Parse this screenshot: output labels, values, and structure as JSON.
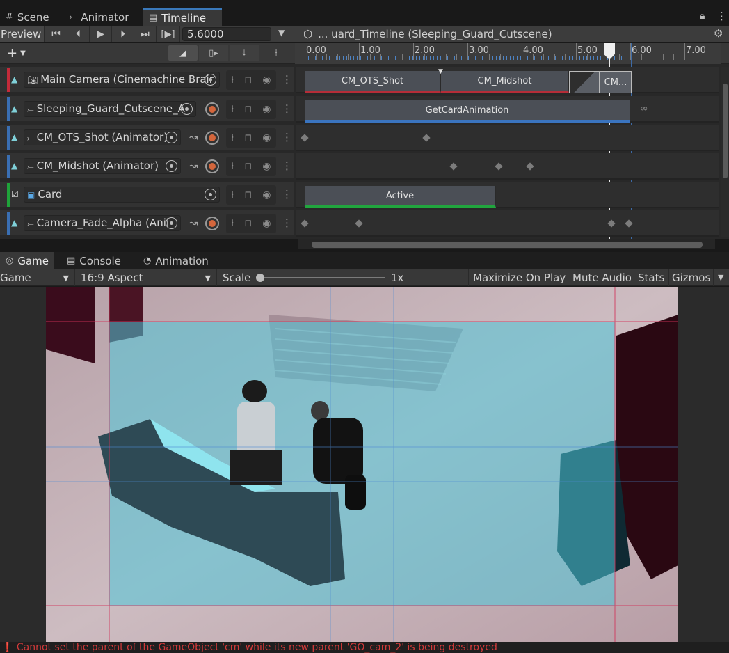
{
  "tabs": {
    "scene": "Scene",
    "animator": "Animator",
    "timeline": "Timeline"
  },
  "toolbar": {
    "preview": "Preview",
    "current_time": "5.6000",
    "timeline_path": "... uard_Timeline (Sleeping_Guard_Cutscene)"
  },
  "ruler": {
    "ticks": [
      "0.00",
      "1.00",
      "2.00",
      "3.00",
      "4.00",
      "5.00",
      "6.00",
      "7.00"
    ]
  },
  "tracks": [
    {
      "name": "Main Camera (Cinemachine Brair",
      "color": "#c42b3a",
      "clips": [
        "CM_OTS_Shot",
        "CM_Midshot",
        "CM..."
      ]
    },
    {
      "name": "Sleeping_Guard_Cutscene_A",
      "color": "#3a6fb3",
      "clips": [
        "GetCardAnimation"
      ]
    },
    {
      "name": "CM_OTS_Shot (Animator)",
      "color": "#3a6fb3",
      "clips": []
    },
    {
      "name": "CM_Midshot (Animator)",
      "color": "#3a6fb3",
      "clips": []
    },
    {
      "name": "Card",
      "color": "#1fa33a",
      "clips": [
        "Active"
      ]
    },
    {
      "name": "Camera_Fade_Alpha (Anii",
      "color": "#3a6fb3",
      "clips": []
    }
  ],
  "bottom_tabs": {
    "game": "Game",
    "console": "Console",
    "animation": "Animation"
  },
  "game_toolbar": {
    "display": "Game",
    "aspect": "16:9 Aspect",
    "scale_label": "Scale",
    "scale_value": "1x",
    "maximize": "Maximize On Play",
    "mute": "Mute Audio",
    "stats": "Stats",
    "gizmos": "Gizmos"
  },
  "status": {
    "message": "Cannot set the parent of the GameObject 'cm' while its new parent 'GO_cam_2' is being destroyed"
  },
  "colors": {
    "accent": "#3a79bb",
    "error": "#d23a3a",
    "camera_track": "#c42b3a",
    "activation_track": "#1fa33a"
  }
}
